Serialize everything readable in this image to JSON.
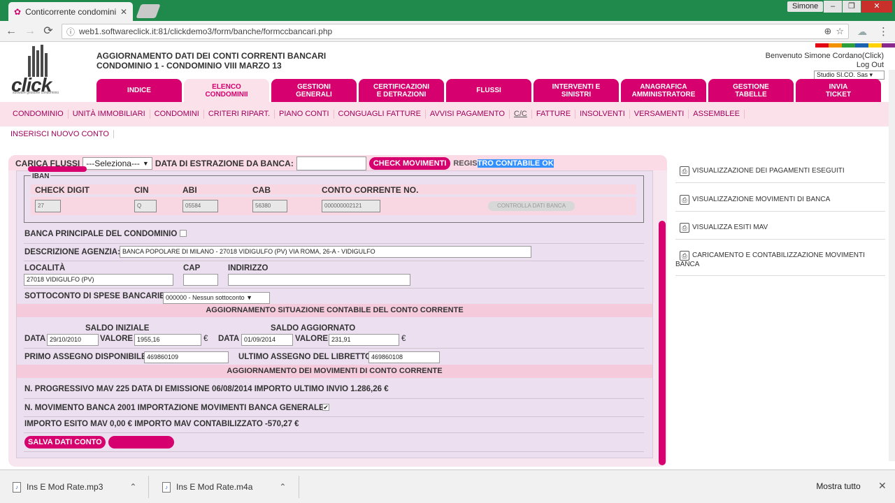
{
  "browser": {
    "tab_title": "Conticorrente condomini",
    "user": "Simone",
    "url": "web1.softwareclick.it:81/clickdemo3/form/banche/formccbancari.php",
    "window_buttons": {
      "min": "–",
      "max": "❐",
      "close": "✕"
    },
    "nav": {
      "back": "←",
      "forward": "→",
      "reload": "⟳"
    },
    "icons": {
      "info": "ⓘ",
      "zoom": "⊕",
      "star": "☆",
      "menu": "⋮"
    },
    "accent_color": "#1f8a4c"
  },
  "header": {
    "logo_word": "click",
    "logo_tagline": "software gestione condominio",
    "title_line1": "AGGIORNAMENTO DATI DEI CONTI CORRENTI BANCARI",
    "title_line2": "CONDOMINIO 1 - CONDOMINIO VIII MARZO 13",
    "welcome": "Benvenuto Simone Cordano(Click)",
    "logout": "Log Out",
    "studio": "Studio SI.CO. Sas",
    "color_strip": [
      "#e30613",
      "#f39200",
      "#2e9f3a",
      "#1e63b0",
      "#ffd200",
      "#8a2a8f"
    ]
  },
  "mainnav": [
    {
      "line1": "INDICE",
      "line2": ""
    },
    {
      "line1": "ELENCO",
      "line2": "CONDOMINII"
    },
    {
      "line1": "GESTIONI",
      "line2": "GENERALI"
    },
    {
      "line1": "CERTIFICAZIONI",
      "line2": "E DETRAZIONI"
    },
    {
      "line1": "FLUSSI",
      "line2": ""
    },
    {
      "line1": "INTERVENTI E",
      "line2": "SINISTRI"
    },
    {
      "line1": "ANAGRAFICA",
      "line2": "AMMINISTRATORE"
    },
    {
      "line1": "GESTIONE",
      "line2": "TABELLE"
    },
    {
      "line1": "INVIA",
      "line2": "TICKET"
    }
  ],
  "subnav": [
    "CONDOMINIO",
    "UNITÀ IMMOBILIARI",
    "CONDOMINI",
    "CRITERI RIPART.",
    "PIANO CONTI",
    "CONGUAGLI FATTURE",
    "AVVISI PAGAMENTO",
    "C/C",
    "FATTURE",
    "INSOLVENTI",
    "VERSAMENTI",
    "ASSEMBLEE"
  ],
  "insert_link": "INSERISCI NUOVO CONTO",
  "flussi": {
    "label": "CARICA FLUSSI",
    "select_value": "---Seleziona---",
    "date_label": "DATA DI ESTRAZIONE DA BANCA:",
    "date_value": "",
    "check_button": "CHECK MOVIMENTI",
    "status_prefix": "REGIS",
    "status_highlight": "TRO CONTABILE OK"
  },
  "iban": {
    "legend": "IBAN",
    "check_digit_label": "CHECK DIGIT",
    "check_digit": "27",
    "cin_label": "CIN",
    "cin": "Q",
    "abi_label": "ABI",
    "abi": "05584",
    "cab_label": "CAB",
    "cab": "56380",
    "conto_label": "CONTO CORRENTE NO.",
    "conto": "000000002121",
    "verify_button": "CONTROLLA DATI BANCA"
  },
  "form": {
    "banca_principale_label": "BANCA PRINCIPALE DEL CONDOMINIO",
    "banca_principale_checked": false,
    "descrizione_label": "DESCRIZIONE AGENZIA:",
    "descrizione": "BANCA POPOLARE DI MILANO - 27018 VIDIGULFO (PV) VIA ROMA, 26-A - VIDIGULFO",
    "localita_label": "LOCALITÀ",
    "localita": "27018 VIDIGULFO (PV)",
    "cap_label": "CAP",
    "cap": "",
    "indirizzo_label": "INDIRIZZO",
    "indirizzo": "",
    "sottoconto_label": "SOTTOCONTO DI SPESE BANCARIE",
    "sottoconto": "000000 - Nessun sottoconto",
    "band_situazione": "AGGIORNAMENTO SITUAZIONE CONTABILE DEL CONTO CORRENTE",
    "saldo_iniziale_label": "SALDO INIZIALE",
    "saldo_aggiornato_label": "SALDO AGGIORNATO",
    "data_label": "DATA",
    "valore_label": "VALORE",
    "euro": "€",
    "saldo_iniziale_data": "29/10/2010",
    "saldo_iniziale_valore": "1955,16",
    "saldo_aggiornato_data": "01/09/2014",
    "saldo_aggiornato_valore": "231,91",
    "primo_assegno_label": "PRIMO ASSEGNO DISPONIBILE",
    "primo_assegno": "469860109",
    "ultimo_assegno_label": "ULTIMO ASSEGNO DEL LIBRETTO",
    "ultimo_assegno": "469860108",
    "band_movimenti": "AGGIORNAMENTO DEI MOVIMENTI DI CONTO CORRENTE",
    "mav_line": "N. PROGRESSIVO MAV 225 DATA DI EMISSIONE 06/08/2014 IMPORTO ULTIMO INVIO 1.286,26 €",
    "movimento_line": "N. MOVIMENTO BANCA 2001 IMPORTAZIONE MOVIMENTI BANCA GENERALE",
    "movimento_checked": true,
    "esito_line": "IMPORTO ESITO MAV 0,00 € IMPORTO MAV CONTABILIZZATO -570,27 €",
    "save_button": "SALVA DATI CONTO"
  },
  "sidebar": [
    "VISUALIZZAZIONE DEI PAGAMENTI ESEGUITI",
    "VISUALIZZAZIONE MOVIMENTI DI BANCA",
    "VISUALIZZA ESITI MAV",
    "CARICAMENTO E CONTABILIZZAZIONE MOVIMENTI BANCA"
  ],
  "downloads": {
    "items": [
      "Ins E Mod Rate.mp3",
      "Ins E Mod Rate.m4a"
    ],
    "show_all": "Mostra tutto",
    "close": "✕"
  },
  "colors": {
    "brand_pink": "#d6006e",
    "panel": "#f7e6ef"
  }
}
